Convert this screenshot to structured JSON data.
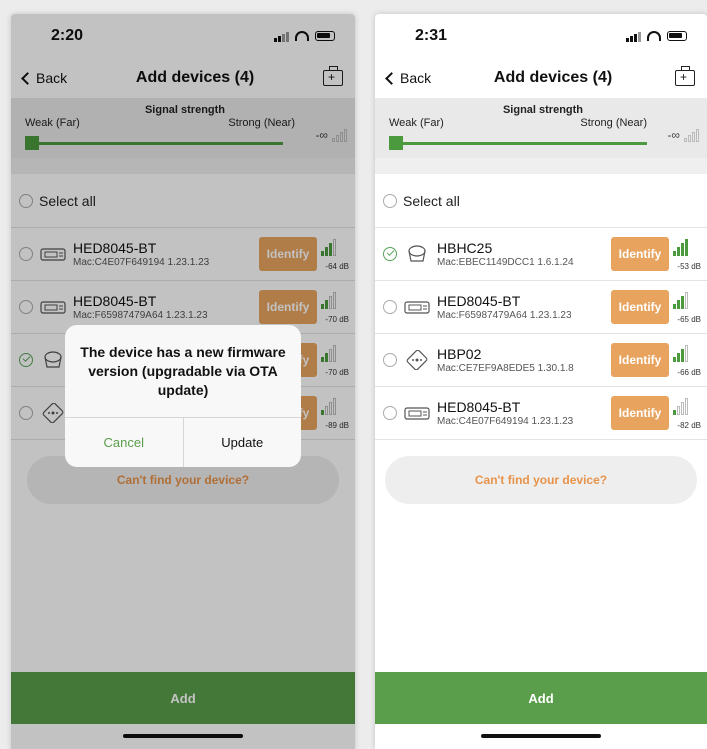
{
  "accent": "#5a9e4b",
  "identify_color": "#e8a45f",
  "left": {
    "time": "2:20",
    "nav": {
      "back": "Back",
      "title": "Add devices (4)",
      "right_icon": "toolbox-icon"
    },
    "signal": {
      "title": "Signal strength",
      "weak": "Weak (Far)",
      "strong": "Strong (Near)",
      "value": "-∞"
    },
    "select_all": "Select all",
    "devices": [
      {
        "name": "HED8045-BT",
        "mac": "Mac:C4E07F649194  1.23.1.23",
        "identify": "Identify",
        "rssi": "-64 dB",
        "checked": false,
        "icon": "bp-monitor-icon"
      },
      {
        "name": "HED8045-BT",
        "mac": "Mac:F65987479A64  1.23.1.23",
        "identify": "Identify",
        "rssi": "-70 dB",
        "checked": false,
        "icon": "bp-monitor-icon"
      },
      {
        "name": "",
        "mac": "",
        "identify": "Identify",
        "rssi": "-70 dB",
        "checked": true,
        "icon": "scale-icon"
      },
      {
        "name": "",
        "mac": "",
        "identify": "Identify",
        "rssi": "-89 dB",
        "checked": false,
        "icon": "chip-device-icon"
      }
    ],
    "cant_find": "Can't find your device?",
    "add": "Add",
    "dialog": {
      "message": "The device has a new firmware version (upgradable via OTA update)",
      "cancel": "Cancel",
      "update": "Update"
    }
  },
  "right": {
    "time": "2:31",
    "nav": {
      "back": "Back",
      "title": "Add devices (4)",
      "right_icon": "toolbox-icon"
    },
    "signal": {
      "title": "Signal strength",
      "weak": "Weak (Far)",
      "strong": "Strong (Near)",
      "value": "-∞"
    },
    "select_all": "Select all",
    "devices": [
      {
        "name": "HBHC25",
        "mac": "Mac:EBEC1149DCC1  1.6.1.24",
        "identify": "Identify",
        "rssi": "-53 dB",
        "checked": true,
        "icon": "scale-icon"
      },
      {
        "name": "HED8045-BT",
        "mac": "Mac:F65987479A64  1.23.1.23",
        "identify": "Identify",
        "rssi": "-65 dB",
        "checked": false,
        "icon": "bp-monitor-icon"
      },
      {
        "name": "HBP02",
        "mac": "Mac:CE7EF9A8EDE5  1.30.1.8",
        "identify": "Identify",
        "rssi": "-66 dB",
        "checked": false,
        "icon": "chip-device-icon"
      },
      {
        "name": "HED8045-BT",
        "mac": "Mac:C4E07F649194  1.23.1.23",
        "identify": "Identify",
        "rssi": "-82 dB",
        "checked": false,
        "icon": "bp-monitor-icon"
      }
    ],
    "cant_find": "Can't find your device?",
    "add": "Add"
  }
}
